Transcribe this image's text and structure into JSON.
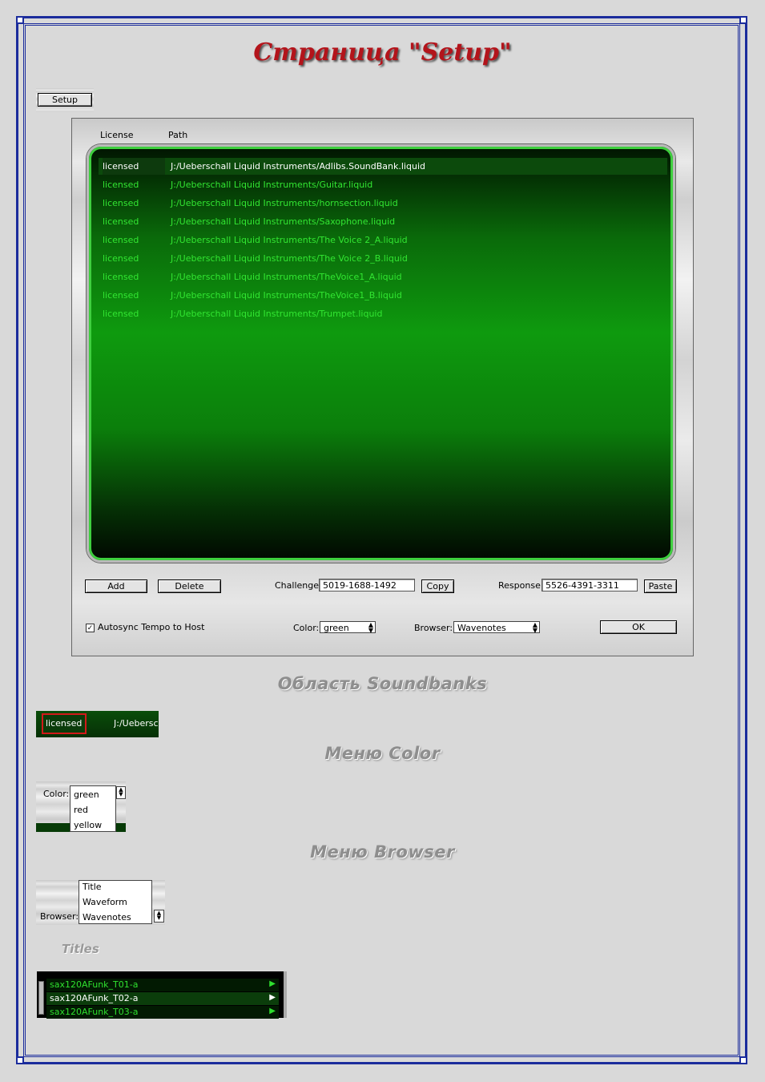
{
  "page_title": "Страница \"Setup\"",
  "setup_button_label": "Setup",
  "panel": {
    "col_license": "License",
    "col_path": "Path",
    "soundbanks": [
      {
        "license": "licensed",
        "path": "J:/Ueberschall Liquid Instruments/Adlibs.SoundBank.liquid",
        "selected": true
      },
      {
        "license": "licensed",
        "path": "J:/Ueberschall Liquid Instruments/Guitar.liquid"
      },
      {
        "license": "licensed",
        "path": "J:/Ueberschall Liquid Instruments/hornsection.liquid"
      },
      {
        "license": "licensed",
        "path": "J:/Ueberschall Liquid Instruments/Saxophone.liquid"
      },
      {
        "license": "licensed",
        "path": "J:/Ueberschall Liquid Instruments/The Voice 2_A.liquid"
      },
      {
        "license": "licensed",
        "path": "J:/Ueberschall Liquid Instruments/The Voice 2_B.liquid"
      },
      {
        "license": "licensed",
        "path": "J:/Ueberschall Liquid Instruments/TheVoice1_A.liquid"
      },
      {
        "license": "licensed",
        "path": "J:/Ueberschall Liquid Instruments/TheVoice1_B.liquid"
      },
      {
        "license": "licensed",
        "path": "J:/Ueberschall Liquid Instruments/Trumpet.liquid"
      }
    ],
    "add_label": "Add",
    "delete_label": "Delete",
    "challenge_label": "Challenge:",
    "challenge_value": "5019-1688-1492",
    "copy_label": "Copy",
    "response_label": "Response:",
    "response_value": "5526-4391-3311",
    "paste_label": "Paste",
    "autosync_label": "Autosync Tempo to Host",
    "autosync_checked": "✓",
    "color_label": "Color:",
    "color_value": "green",
    "browser_label": "Browser:",
    "browser_value": "Wavenotes",
    "ok_label": "OK"
  },
  "soundbanks_heading": "Область Soundbanks",
  "crop_soundbank": {
    "license": "licensed",
    "path": "J:/Ueberschall"
  },
  "color_heading": "Меню Color",
  "color_menu": {
    "label": "Color:",
    "options": [
      "green",
      "red",
      "yellow"
    ]
  },
  "browser_heading": "Меню Browser",
  "browser_menu": {
    "label": "Browser:",
    "options": [
      "Title",
      "Waveform",
      "Wavenotes"
    ]
  },
  "titles_heading": "Titles",
  "titles_list": [
    "sax120AFunk_T01-a",
    "sax120AFunk_T02-a",
    "sax120AFunk_T03-a"
  ],
  "colors": {
    "frame": "#1b2c9c",
    "title_red": "#b3141b",
    "green_text": "#32e632"
  }
}
